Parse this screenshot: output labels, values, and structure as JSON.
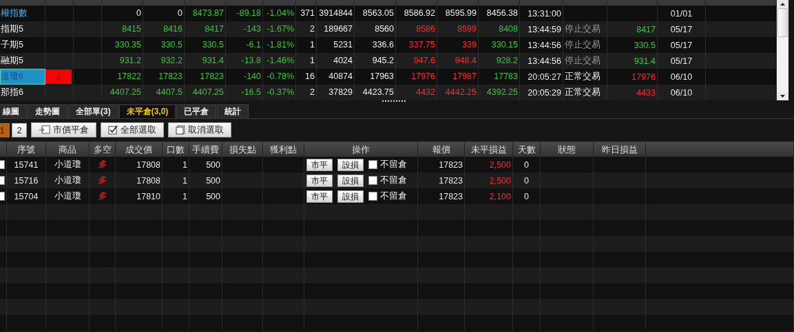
{
  "quotes": {
    "rows": [
      {
        "name": "權指數",
        "kind": "index",
        "selected": false,
        "cells": [
          {
            "text": "0"
          },
          {
            "text": "0"
          },
          {
            "text": "8473.87",
            "color": "#38c838"
          },
          {
            "text": "-89.18",
            "color": "#38c838"
          },
          {
            "text": "-1.04%",
            "color": "#38c838"
          },
          {
            "text": "371",
            "color": "#eeeeee"
          },
          {
            "text": "3914844",
            "color": "#eeeeee"
          },
          {
            "text": "8563.05",
            "color": "#eeeeee"
          },
          {
            "text": "8586.92",
            "color": "#eeeeee"
          },
          {
            "text": "8595.99",
            "color": "#eeeeee"
          },
          {
            "text": "8456.38",
            "color": "#eeeeee"
          }
        ],
        "time": "13:31:00",
        "date": "01/01"
      },
      {
        "name": "指期5",
        "kind": "future",
        "selected": false,
        "cells": [
          {
            "text": "8415",
            "color": "#38c838"
          },
          {
            "text": "8416",
            "color": "#38c838"
          },
          {
            "text": "8417",
            "color": "#38c838"
          },
          {
            "text": "-143",
            "color": "#38c838"
          },
          {
            "text": "-1.67%",
            "color": "#38c838"
          },
          {
            "text": "2",
            "color": "#eeeeee"
          },
          {
            "text": "189667",
            "color": "#eeeeee"
          },
          {
            "text": "8560",
            "color": "#eeeeee"
          },
          {
            "text": "8586",
            "color": "#ff2a2a"
          },
          {
            "text": "8599",
            "color": "#ff2a2a"
          },
          {
            "text": "8408",
            "color": "#38c838"
          }
        ],
        "time": "13:44:59",
        "status": {
          "text": "停止交易",
          "kind": "stopped"
        },
        "settle": {
          "text": "8417",
          "color": "#38c838"
        },
        "date": "05/17"
      },
      {
        "name": "子期5",
        "kind": "future",
        "selected": false,
        "cells": [
          {
            "text": "330.35",
            "color": "#38c838"
          },
          {
            "text": "330.5",
            "color": "#38c838"
          },
          {
            "text": "330.5",
            "color": "#38c838"
          },
          {
            "text": "-6.1",
            "color": "#38c838"
          },
          {
            "text": "-1.81%",
            "color": "#38c838"
          },
          {
            "text": "1",
            "color": "#eeeeee"
          },
          {
            "text": "5231",
            "color": "#eeeeee"
          },
          {
            "text": "336.6",
            "color": "#eeeeee"
          },
          {
            "text": "337.75",
            "color": "#ff2a2a"
          },
          {
            "text": "339",
            "color": "#ff2a2a"
          },
          {
            "text": "330.15",
            "color": "#38c838"
          }
        ],
        "time": "13:44:56",
        "status": {
          "text": "停止交易",
          "kind": "stopped"
        },
        "settle": {
          "text": "330.5",
          "color": "#38c838"
        },
        "date": "05/17"
      },
      {
        "name": "融期5",
        "kind": "future",
        "selected": false,
        "cells": [
          {
            "text": "931.2",
            "color": "#38c838"
          },
          {
            "text": "932.2",
            "color": "#38c838"
          },
          {
            "text": "931.4",
            "color": "#38c838"
          },
          {
            "text": "-13.8",
            "color": "#38c838"
          },
          {
            "text": "-1.46%",
            "color": "#38c838"
          },
          {
            "text": "1",
            "color": "#eeeeee"
          },
          {
            "text": "4024",
            "color": "#eeeeee"
          },
          {
            "text": "945.2",
            "color": "#eeeeee"
          },
          {
            "text": "947.6",
            "color": "#ff2a2a"
          },
          {
            "text": "948.4",
            "color": "#ff2a2a"
          },
          {
            "text": "928.2",
            "color": "#38c838"
          }
        ],
        "time": "13:44:56",
        "status": {
          "text": "停止交易",
          "kind": "stopped"
        },
        "settle": {
          "text": "931.4",
          "color": "#38c838"
        },
        "date": "05/17"
      },
      {
        "name": "道瓊6",
        "kind": "future",
        "selected": true,
        "badge": "3",
        "cells": [
          {
            "text": "17822",
            "color": "#38c838"
          },
          {
            "text": "17823",
            "color": "#38c838"
          },
          {
            "text": "17823",
            "color": "#38c838"
          },
          {
            "text": "-140",
            "color": "#38c838"
          },
          {
            "text": "-0.78%",
            "color": "#38c838"
          },
          {
            "text": "16",
            "color": "#eeeeee"
          },
          {
            "text": "40874",
            "color": "#eeeeee"
          },
          {
            "text": "17963",
            "color": "#eeeeee"
          },
          {
            "text": "17976",
            "color": "#ff2a2a"
          },
          {
            "text": "17987",
            "color": "#ff2a2a"
          },
          {
            "text": "17783",
            "color": "#38c838"
          }
        ],
        "time": "20:05:27",
        "status": {
          "text": "正常交易",
          "kind": "normal"
        },
        "settle": {
          "text": "17976",
          "color": "#ff2a2a"
        },
        "date": "06/10"
      },
      {
        "name": "那指6",
        "kind": "future",
        "selected": false,
        "cells": [
          {
            "text": "4407.25",
            "color": "#38c838"
          },
          {
            "text": "4407.5",
            "color": "#38c838"
          },
          {
            "text": "4407.25",
            "color": "#38c838"
          },
          {
            "text": "-16.5",
            "color": "#38c838"
          },
          {
            "text": "-0.37%",
            "color": "#38c838"
          },
          {
            "text": "2",
            "color": "#eeeeee"
          },
          {
            "text": "37829",
            "color": "#eeeeee"
          },
          {
            "text": "4423.75",
            "color": "#eeeeee"
          },
          {
            "text": "4432",
            "color": "#ff2a2a"
          },
          {
            "text": "4442.25",
            "color": "#ff2a2a"
          },
          {
            "text": "4392.25",
            "color": "#38c838"
          }
        ],
        "time": "20:05:29",
        "status": {
          "text": "正常交易",
          "kind": "normal"
        },
        "settle": {
          "text": "4433",
          "color": "#ff2a2a"
        },
        "date": "06/10"
      }
    ]
  },
  "tabs": [
    {
      "label": "線圖",
      "selected": false
    },
    {
      "label": "走勢圖",
      "selected": false
    },
    {
      "label": "全部單(3)",
      "selected": false
    },
    {
      "label": "未平倉(3,0)",
      "selected": true
    },
    {
      "label": "已平倉",
      "selected": false
    },
    {
      "label": "統計",
      "selected": false
    }
  ],
  "pages": [
    {
      "label": "1",
      "selected": true
    },
    {
      "label": "2",
      "selected": false
    }
  ],
  "actions": [
    {
      "label": "市價平倉",
      "kind": "close"
    },
    {
      "label": "全部選取",
      "kind": "select"
    },
    {
      "label": "取消選取",
      "kind": "deselect"
    }
  ],
  "positions": {
    "columns": [
      "序號",
      "商品",
      "多空",
      "成交價",
      "口數",
      "手續費",
      "損失點",
      "獲利點",
      "操作",
      "報價",
      "未平損益",
      "天數",
      "狀態",
      "昨日損益"
    ],
    "rows": [
      {
        "checked": false,
        "id": "15741",
        "product": "小道瓊",
        "side": "多",
        "price": "17808",
        "qty": "1",
        "fee": "500",
        "close_button": "市平",
        "stop_button": "設損",
        "keep": {
          "label": "不留倉",
          "checked": false
        },
        "quote": "17823",
        "pnl": {
          "text": "2,500",
          "color": "#ff2a2a"
        },
        "days": "0"
      },
      {
        "checked": false,
        "id": "15716",
        "product": "小道瓊",
        "side": "多",
        "price": "17808",
        "qty": "1",
        "fee": "500",
        "close_button": "市平",
        "stop_button": "設損",
        "keep": {
          "label": "不留倉",
          "checked": false
        },
        "quote": "17823",
        "pnl": {
          "text": "2,500",
          "color": "#ff2a2a"
        },
        "days": "0"
      },
      {
        "checked": false,
        "id": "15704",
        "product": "小道瓊",
        "side": "多",
        "price": "17810",
        "qty": "1",
        "fee": "500",
        "close_button": "市平",
        "stop_button": "設損",
        "keep": {
          "label": "不留倉",
          "checked": false
        },
        "quote": "17823",
        "pnl": {
          "text": "2,100",
          "color": "#ff2a2a"
        },
        "days": "0"
      }
    ]
  }
}
